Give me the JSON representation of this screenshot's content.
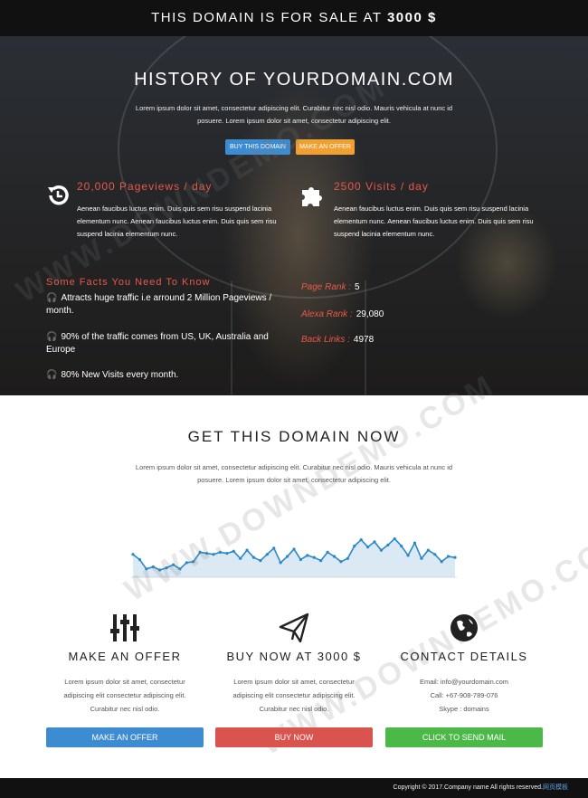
{
  "topbar": {
    "prefix": "THIS DOMAIN IS FOR SALE AT",
    "price": "3000 $"
  },
  "hero": {
    "title": "HISTORY OF YOURDOMAIN.COM",
    "subtitle": "Lorem ipsum dolor sit amet, consectetur adipiscing elit. Curabitur nec nisl odio. Mauris vehicula at nunc id posuere. Lorem ipsum dolor sit amet, consectetur adipiscing elit.",
    "buy_button": "BUY THIS DOMAIN",
    "offer_button": "MAKE AN OFFER"
  },
  "stats": [
    {
      "icon": "history-icon",
      "title": "20,000 Pageviews / day",
      "text": "Aenean faucibus luctus enim. Duis quis sem risu suspend lacinia elementum nunc. Aenean faucibus luctus enim. Duis quis sem risu suspend lacinia elementum nunc."
    },
    {
      "icon": "puzzle-icon",
      "title": "2500 Visits / day",
      "text": "Aenean faucibus luctus enim. Duis quis sem risu suspend lacinia elementum nunc. Aenean faucibus luctus enim. Duis quis sem risu suspend lacinia elementum nunc."
    }
  ],
  "facts": {
    "title": "Some Facts You Need To Know",
    "items": [
      "Attracts huge traffic i.e arround 2 Million Pageviews / month.",
      "90% of the traffic comes from US, UK, Australia and Europe",
      "80% New Visits every month."
    ]
  },
  "ranks": [
    {
      "label": "Page Rank :",
      "value": "5"
    },
    {
      "label": "Alexa Rank :",
      "value": "29,080"
    },
    {
      "label": "Back Links :",
      "value": "4978"
    }
  ],
  "watermark": "WWW.DOWNDEMO.COM",
  "get_domain": {
    "title": "GET THIS DOMAIN NOW",
    "subtitle": "Lorem ipsum dolor sit amet, consectetur adipiscing elit. Curabitur nec nisl odio. Mauris vehicula at nunc id posuere. Lorem ipsum dolor sit amet, consectetur adipiscing elit."
  },
  "traffic_chart": {
    "values": [
      22,
      17,
      8,
      10,
      7,
      9,
      12,
      8,
      14,
      15,
      24,
      23,
      22,
      24,
      23,
      25,
      18,
      26,
      19,
      16,
      22,
      28,
      14,
      20,
      27,
      17,
      21,
      19,
      16,
      24,
      20,
      15,
      18,
      30,
      36,
      29,
      34,
      26,
      31,
      37,
      30,
      21,
      33,
      18,
      26,
      22,
      15,
      20,
      19
    ],
    "ticks": [
      "",
      "",
      "",
      "",
      "",
      "",
      "",
      "",
      ""
    ],
    "ymax": 40
  },
  "columns": [
    {
      "icon": "sliders-icon",
      "title": "MAKE AN OFFER",
      "lines": [
        "Lorem ipsum dolor sit amet, consectetur",
        "adipiscing elit consectetur adipiscing elit.",
        "Curabitur nec nisl odio."
      ],
      "button": "MAKE AN OFFER"
    },
    {
      "icon": "paper-plane-icon",
      "title": "BUY NOW AT 3000 $",
      "lines": [
        "Lorem ipsum dolor sit amet, consectetur",
        "adipiscing elit consectetur adipiscing elit.",
        "Curabitur nec nisl odio."
      ],
      "button": "BUY NOW"
    },
    {
      "icon": "globe-icon",
      "title": "CONTACT DETAILS",
      "lines": [
        "Email: info@yourdomain.com",
        "Call: +67-908-789-076",
        "Skype : domains"
      ],
      "button": "CLICK TO SEND MAIL"
    }
  ],
  "footer": {
    "text": "Copyright © 2017.Company name All rights reserved.",
    "link": "网页模板"
  },
  "colors": {
    "accent_red": "#e8584a",
    "blue": "#3d8bd0",
    "orange": "#f0a030",
    "red": "#d9534f",
    "green": "#4cb848"
  }
}
